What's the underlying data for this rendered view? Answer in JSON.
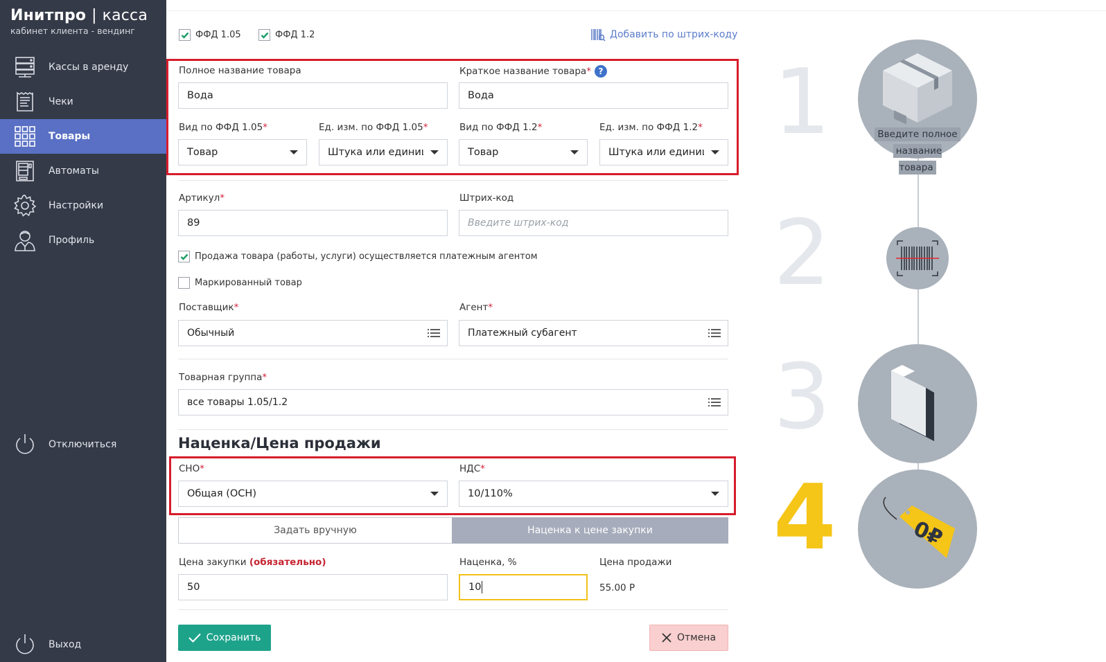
{
  "app": {
    "brand_bold": "Инитпро",
    "brand_sep": "|",
    "brand_thin": "касса",
    "subtitle": "кабинет клиента - вендинг"
  },
  "nav": [
    {
      "label": "Кассы в аренду",
      "icon": "server-icon"
    },
    {
      "label": "Чеки",
      "icon": "receipt-icon"
    },
    {
      "label": "Товары",
      "icon": "grid-icon",
      "active": true
    },
    {
      "label": "Автоматы",
      "icon": "vending-machine-icon"
    },
    {
      "label": "Настройки",
      "icon": "gear-icon"
    },
    {
      "label": "Профиль",
      "icon": "user-icon"
    }
  ],
  "disconnect_label": "Отключиться",
  "exit_label": "Выход",
  "form": {
    "ffd105": "ФФД 1.05",
    "ffd12": "ФФД 1.2",
    "add_by_barcode": "Добавить по штрих-коду",
    "full_name_label": "Полное название товара",
    "full_name_value": "Вода",
    "short_name_label": "Краткое название товара",
    "short_name_value": "Вода",
    "type105_label": "Вид по ФФД 1.05",
    "type105_value": "Товар",
    "unit105_label": "Ед. изм. по ФФД 1.05",
    "unit105_value": "Штука или единица",
    "type12_label": "Вид по ФФД 1.2",
    "type12_value": "Товар",
    "unit12_label": "Ед. изм. по ФФД 1.2",
    "unit12_value": "Штука или единица",
    "article_label": "Артикул",
    "article_value": "89",
    "barcode_label": "Штрих-код",
    "barcode_placeholder": "Введите штрих-код",
    "agent_sale_label": "Продажа товара (работы, услуги) осуществляется платежным агентом",
    "marked_label": "Маркированный товар",
    "supplier_label": "Поставщик",
    "supplier_value": "Обычный",
    "agent_label": "Агент",
    "agent_value": "Платежный субагент",
    "group_label": "Товарная группа",
    "group_value": "все товары 1.05/1.2",
    "section_title": "Наценка/Цена продажи",
    "sno_label": "СНО",
    "sno_value": "Общая (ОСН)",
    "nds_label": "НДС",
    "nds_value": "10/110%",
    "seg_manual": "Задать вручную",
    "seg_markup": "Наценка к цене закупки",
    "purchase_label": "Цена закупки",
    "purchase_required": "(обязательно)",
    "purchase_value": "50",
    "markup_label": "Наценка, %",
    "markup_value": "10",
    "sale_price_label": "Цена продажи",
    "sale_price_value": "55.00 Р",
    "save": "Сохранить",
    "cancel": "Отмена"
  },
  "steps": {
    "n1": "1",
    "n2": "2",
    "n3": "3",
    "n4": "4",
    "tip_line1": "Введите полное",
    "tip_line2": "название товара",
    "price_tag": "0₽",
    "active_color": "#f5c518"
  },
  "colors": {
    "sidebar": "#353a48",
    "active_nav": "#5970c4",
    "save": "#1ea38b",
    "cancel": "#f9cfcf",
    "highlight": "#d71c2b"
  }
}
